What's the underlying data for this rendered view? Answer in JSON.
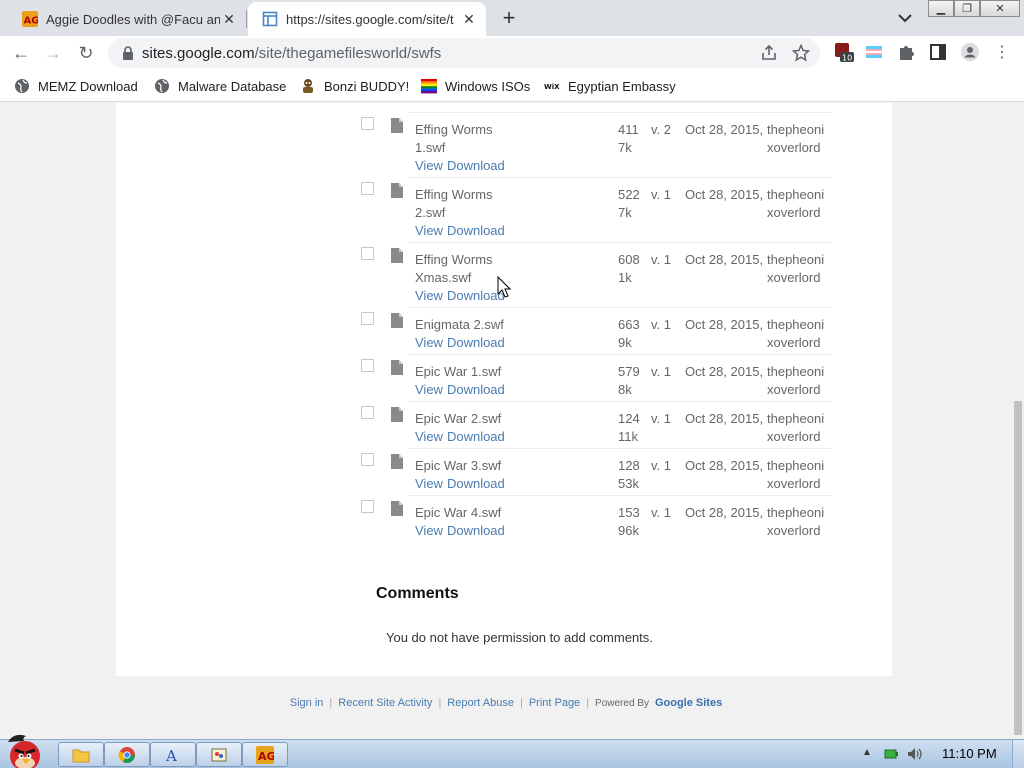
{
  "browser": {
    "tabs": [
      {
        "title": "Aggie Doodles with @Facu an",
        "active": false,
        "favicon": "ag-logo-icon"
      },
      {
        "title": "https://sites.google.com/site/t",
        "active": true,
        "favicon": "sites-page-icon"
      }
    ],
    "url": {
      "host": "sites.google.com",
      "path": "/site/thegamefilesworld/swfs"
    },
    "extension_badge": "10",
    "bookmarks": [
      {
        "label": "MEMZ Download",
        "icon": "globe-icon"
      },
      {
        "label": "Malware Database",
        "icon": "globe-icon"
      },
      {
        "label": "Bonzi BUDDY!",
        "icon": "bonzi-icon"
      },
      {
        "label": "Windows ISOs",
        "icon": "rainbow-flag-icon"
      },
      {
        "label": "Egyptian Embassy",
        "icon": "wix-icon"
      }
    ]
  },
  "files": {
    "view_label": "View",
    "download_label": "Download",
    "rows": [
      {
        "name1": "Effing Worms",
        "name2": "1.swf",
        "size1": "411",
        "size2": "7k",
        "version": "v. 2",
        "date": "Oct 28, 2015, 3",
        "user1": "thepheoni",
        "user2": "xoverlord"
      },
      {
        "name1": "Effing Worms",
        "name2": "2.swf",
        "size1": "522",
        "size2": "7k",
        "version": "v. 1",
        "date": "Oct 28, 2015, 3",
        "user1": "thepheoni",
        "user2": "xoverlord"
      },
      {
        "name1": "Effing Worms",
        "name2": "Xmas.swf",
        "size1": "608",
        "size2": "1k",
        "version": "v. 1",
        "date": "Oct 28, 2015, 3",
        "user1": "thepheoni",
        "user2": "xoverlord"
      },
      {
        "name1": "Enigmata 2.swf",
        "name2": "",
        "size1": "663",
        "size2": "9k",
        "version": "v. 1",
        "date": "Oct 28, 2015, 3",
        "user1": "thepheoni",
        "user2": "xoverlord"
      },
      {
        "name1": "Epic War 1.swf",
        "name2": "",
        "size1": "579",
        "size2": "8k",
        "version": "v. 1",
        "date": "Oct 28, 2015, 3",
        "user1": "thepheoni",
        "user2": "xoverlord"
      },
      {
        "name1": "Epic War 2.swf",
        "name2": "",
        "size1": "124",
        "size2": "11k",
        "version": "v. 1",
        "date": "Oct 28, 2015, 3",
        "user1": "thepheoni",
        "user2": "xoverlord"
      },
      {
        "name1": "Epic War 3.swf",
        "name2": "",
        "size1": "128",
        "size2": "53k",
        "version": "v. 1",
        "date": "Oct 28, 2015, 5",
        "user1": "thepheoni",
        "user2": "xoverlord"
      },
      {
        "name1": "Epic War 4.swf",
        "name2": "",
        "size1": "153",
        "size2": "96k",
        "version": "v. 1",
        "date": "Oct 28, 2015, 5",
        "user1": "thepheoni",
        "user2": "xoverlord"
      }
    ]
  },
  "comments": {
    "heading": "Comments",
    "message": "You do not have permission to add comments."
  },
  "footer": {
    "sign_in": "Sign in",
    "recent_activity": "Recent Site Activity",
    "report_abuse": "Report Abuse",
    "print_page": "Print Page",
    "powered_by": "Powered By",
    "google_sites": "Google Sites"
  },
  "taskbar": {
    "clock": "11:10 PM"
  }
}
